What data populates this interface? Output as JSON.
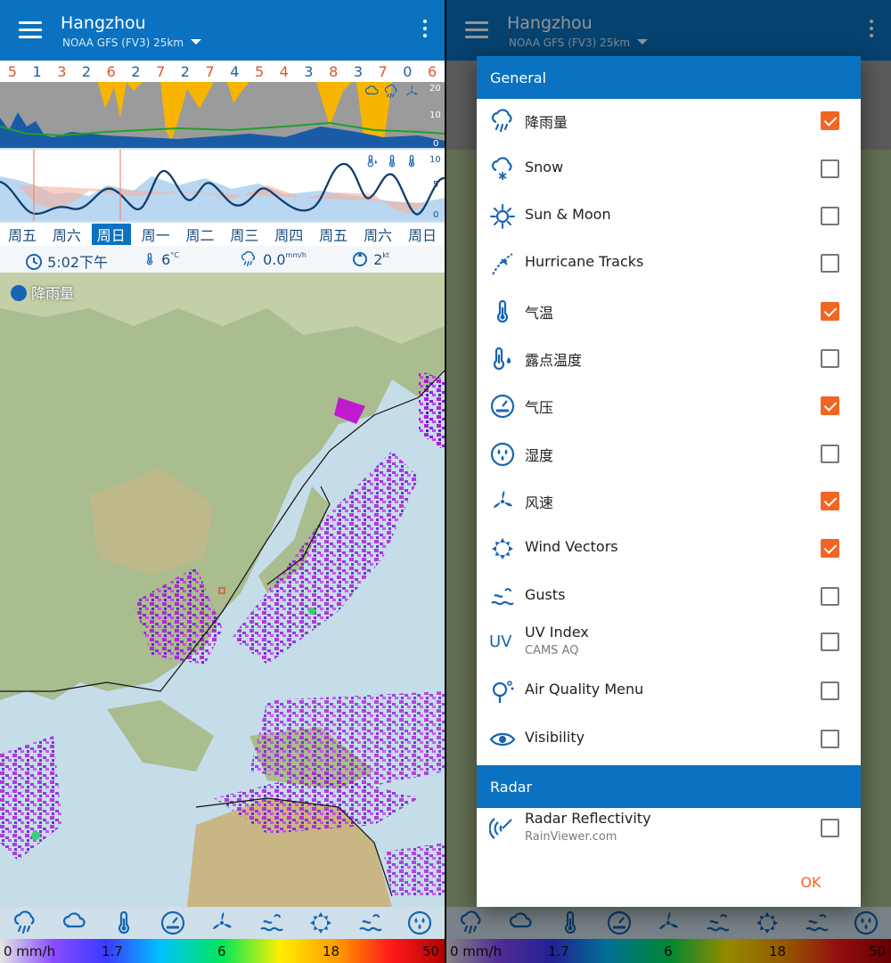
{
  "app": {
    "city": "Hangzhou",
    "model": "NOAA GFS (FV3) 25km"
  },
  "forecast": {
    "top_numbers": [
      {
        "v": "5",
        "c": "#e2542a"
      },
      {
        "v": "1",
        "c": "#1f5fa6"
      },
      {
        "v": "3",
        "c": "#e2542a"
      },
      {
        "v": "2",
        "c": "#1f5fa6"
      },
      {
        "v": "6",
        "c": "#e2542a"
      },
      {
        "v": "2",
        "c": "#1f5fa6"
      },
      {
        "v": "7",
        "c": "#e2542a"
      },
      {
        "v": "2",
        "c": "#1f5fa6"
      },
      {
        "v": "7",
        "c": "#e2542a"
      },
      {
        "v": "4",
        "c": "#1f5fa6"
      },
      {
        "v": "5",
        "c": "#e2542a"
      },
      {
        "v": "4",
        "c": "#e2542a"
      },
      {
        "v": "3",
        "c": "#1f5fa6"
      },
      {
        "v": "8",
        "c": "#e2542a"
      },
      {
        "v": "3",
        "c": "#1f5fa6"
      },
      {
        "v": "7",
        "c": "#e2542a"
      },
      {
        "v": "0",
        "c": "#1f5fa6"
      },
      {
        "v": "6",
        "c": "#e2542a"
      }
    ],
    "chart1_ticks": [
      "20",
      "10",
      "0"
    ],
    "chart2_ticks": [
      "10",
      "5",
      "0"
    ],
    "days": [
      "周五",
      "周六",
      "周日",
      "周一",
      "周二",
      "周三",
      "周四",
      "周五",
      "周六",
      "周日"
    ],
    "active_day_index": 2,
    "time": "5:02下午",
    "temp": "6",
    "temp_unit": "°C",
    "precip": "0.0",
    "precip_unit": "mm/h",
    "wind": "2",
    "wind_unit": "kt"
  },
  "map": {
    "layer_label": "降雨量"
  },
  "legend": {
    "labels": [
      "0 mm/h",
      "1.7",
      "6",
      "18",
      "50"
    ]
  },
  "dialog": {
    "section_general": "General",
    "section_radar": "Radar",
    "items": [
      {
        "label": "降雨量",
        "sub": "",
        "checked": true,
        "icon": "rain-cloud-icon"
      },
      {
        "label": "Snow",
        "sub": "",
        "checked": false,
        "icon": "snow-cloud-icon"
      },
      {
        "label": "Sun & Moon",
        "sub": "",
        "checked": false,
        "icon": "sun-icon"
      },
      {
        "label": "Hurricane Tracks",
        "sub": "",
        "checked": false,
        "icon": "hurricane-track-icon"
      },
      {
        "label": "气温",
        "sub": "",
        "checked": true,
        "icon": "thermometer-icon"
      },
      {
        "label": "露点温度",
        "sub": "",
        "checked": false,
        "icon": "dew-point-icon"
      },
      {
        "label": "气压",
        "sub": "",
        "checked": true,
        "icon": "pressure-gauge-icon"
      },
      {
        "label": "湿度",
        "sub": "",
        "checked": false,
        "icon": "humidity-icon"
      },
      {
        "label": "风速",
        "sub": "",
        "checked": true,
        "icon": "wind-turbine-icon"
      },
      {
        "label": "Wind Vectors",
        "sub": "",
        "checked": true,
        "icon": "wind-vectors-icon"
      },
      {
        "label": "Gusts",
        "sub": "",
        "checked": false,
        "icon": "gusts-icon"
      },
      {
        "label": "UV Index",
        "sub": "CAMS AQ",
        "checked": false,
        "icon": "uv-icon"
      },
      {
        "label": "Air Quality Menu",
        "sub": "",
        "checked": false,
        "icon": "air-quality-icon"
      },
      {
        "label": "Visibility",
        "sub": "",
        "checked": false,
        "icon": "eye-icon"
      }
    ],
    "radar_item": {
      "label": "Radar Reflectivity",
      "sub": "RainViewer.com",
      "checked": false,
      "icon": "radar-icon"
    },
    "ok_label": "OK"
  },
  "colors": {
    "primary": "#0a72c1",
    "accent": "#f26522",
    "checkbox_border": "#777777"
  }
}
